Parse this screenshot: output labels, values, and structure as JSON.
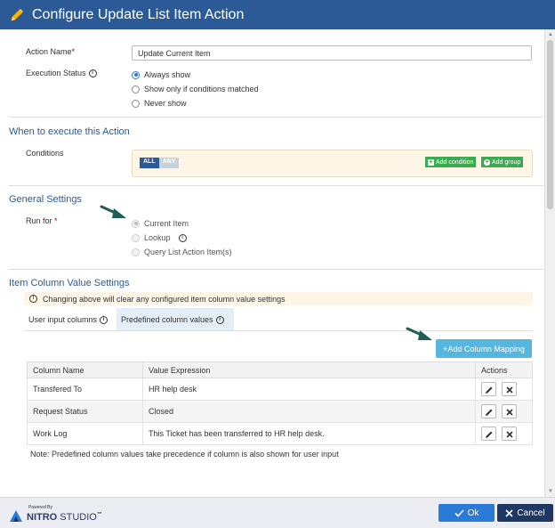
{
  "window": {
    "title": "Configure Update List Item Action"
  },
  "action_name": {
    "label": "Action Name",
    "required_mark": "*",
    "value": "Update Current Item"
  },
  "execution_status": {
    "label": "Execution Status",
    "options": [
      "Always show",
      "Show only if conditions matched",
      "Never show"
    ],
    "selected": "Always show"
  },
  "when_section": {
    "title": "When to execute this Action",
    "conditions_label": "Conditions",
    "toggle": {
      "all": "ALL",
      "any": "ANY",
      "selected": "ALL"
    },
    "add_condition": "Add condition",
    "add_group": "Add group"
  },
  "general_section": {
    "title": "General Settings",
    "run_for_label": "Run for",
    "required_mark": "*",
    "options": [
      "Current Item",
      "Lookup",
      "Query List Action Item(s)"
    ],
    "selected": "Current Item"
  },
  "item_column_section": {
    "title": "Item Column Value Settings",
    "warning": "Changing above will clear any configured item column value settings",
    "tabs": [
      "User input columns",
      "Predefined column values"
    ],
    "active_tab": "Predefined column values",
    "add_mapping": "Add Column Mapping",
    "columns": [
      "Column Name",
      "Value Expression",
      "Actions"
    ],
    "rows": [
      {
        "column": "Transfered To",
        "value": "HR help desk"
      },
      {
        "column": "Request Status",
        "value": "Closed"
      },
      {
        "column": "Work Log",
        "value": "This Ticket has been transferred to HR help desk."
      }
    ],
    "note": "Note: Predefined column values take precedence if column is also shown for user input"
  },
  "footer": {
    "powered_by": "Powered By",
    "brand": "NITRO",
    "brand_suffix": "STUDIO",
    "trademark": "™",
    "ok": "Ok",
    "cancel": "Cancel"
  },
  "colors": {
    "title_bar": "#2c5a97",
    "section_title": "#2c5a97",
    "green_button": "#3aab4e",
    "add_mapping_button": "#55b6e0",
    "ok_button": "#2a7ad8",
    "cancel_button": "#1f3763",
    "arrow": "#1f5e55"
  },
  "icons": [
    "pencil-icon",
    "info-icon",
    "plus-icon",
    "edit-icon",
    "delete-icon",
    "check-icon",
    "close-icon",
    "arrow-icon",
    "nitro-logo"
  ]
}
